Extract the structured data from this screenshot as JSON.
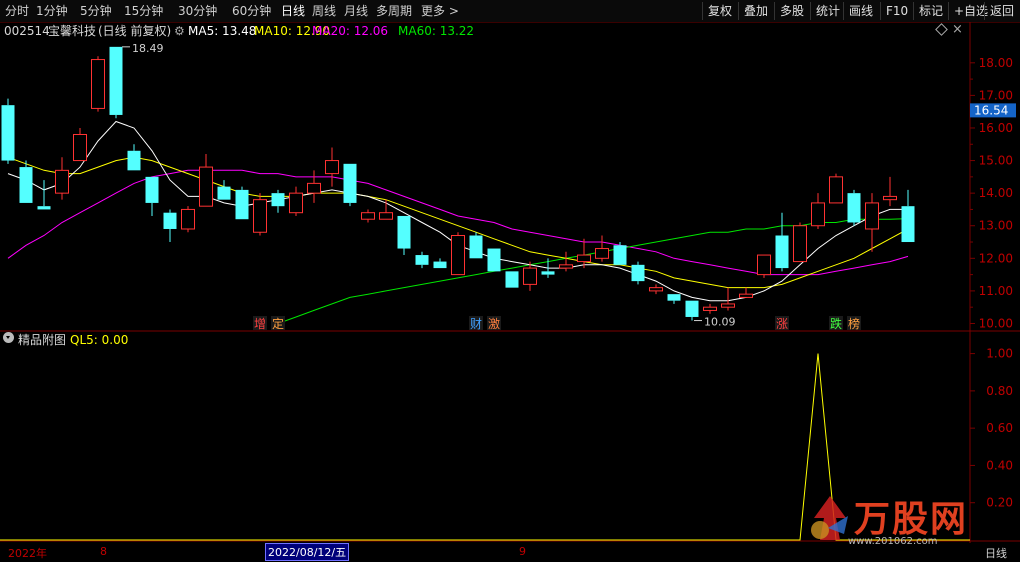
{
  "toolbar": {
    "periods": [
      "分时",
      "1分钟",
      "5分钟",
      "15分钟",
      "30分钟",
      "60分钟",
      "日线",
      "周线",
      "月线",
      "多周期",
      "更多"
    ],
    "active_period": "日线",
    "right_buttons": [
      "复权",
      "叠加",
      "多股",
      "统计",
      "画线",
      "F10",
      "标记",
      "+自选",
      "返回"
    ]
  },
  "stock": {
    "code": "002514",
    "name": "宝馨科技",
    "mode": "(日线 前复权)"
  },
  "ma": {
    "ma5": "MA5: 13.48",
    "ma10": "MA10: 12.90",
    "ma20": "MA20: 12.06",
    "ma60": "MA60: 13.22"
  },
  "colors": {
    "up": "#ff3232",
    "down": "#54ffff",
    "ma5": "#ffffff",
    "ma10": "#ffff00",
    "ma20": "#ff00ff",
    "ma60": "#00e600",
    "grid": "#7a0000",
    "axis_text": "#c00000",
    "ql5": "#ffff00"
  },
  "price_axis": {
    "labels": [
      "18.00",
      "17.00",
      "16.00",
      "15.00",
      "14.00",
      "13.00",
      "12.00",
      "11.00",
      "10.00"
    ],
    "current_price": "16.54"
  },
  "annotations": {
    "high_label": "18.49",
    "low_label": "10.09"
  },
  "events": [
    {
      "text": "增",
      "color": "#ff4040"
    },
    {
      "text": "定",
      "color": "#ffa040"
    },
    {
      "text": "财",
      "color": "#40a0ff"
    },
    {
      "text": "激",
      "color": "#ff8040"
    },
    {
      "text": "涨",
      "color": "#ff4040"
    },
    {
      "text": "跌",
      "color": "#40ff40"
    },
    {
      "text": "榜",
      "color": "#ffa040"
    }
  ],
  "indicator": {
    "name": "精品附图",
    "ql5_label": "QL5: 0.00",
    "axis_labels": [
      "1.00",
      "0.80",
      "0.60",
      "0.40",
      "0.20"
    ]
  },
  "timeline": {
    "year": "2022年",
    "month1": "8",
    "cursor_date": "2022/08/12/五",
    "month2": "9",
    "period_label": "日线"
  },
  "watermark": {
    "text": "万股网",
    "url": "www.201062.com"
  },
  "candles": [
    {
      "o": 16.7,
      "h": 16.9,
      "l": 14.9,
      "c": 15.0
    },
    {
      "o": 14.8,
      "h": 15.0,
      "l": 13.7,
      "c": 13.7
    },
    {
      "o": 13.6,
      "h": 14.4,
      "l": 13.5,
      "c": 13.5
    },
    {
      "o": 14.0,
      "h": 15.1,
      "l": 13.8,
      "c": 14.7
    },
    {
      "o": 15.0,
      "h": 16.0,
      "l": 15.0,
      "c": 15.8
    },
    {
      "o": 16.6,
      "h": 18.2,
      "l": 16.5,
      "c": 18.1
    },
    {
      "o": 18.49,
      "h": 18.49,
      "l": 16.3,
      "c": 16.4
    },
    {
      "o": 15.3,
      "h": 15.5,
      "l": 14.7,
      "c": 14.7
    },
    {
      "o": 14.5,
      "h": 14.5,
      "l": 13.3,
      "c": 13.7
    },
    {
      "o": 13.4,
      "h": 13.5,
      "l": 12.5,
      "c": 12.9
    },
    {
      "o": 12.9,
      "h": 13.6,
      "l": 12.8,
      "c": 13.5
    },
    {
      "o": 13.6,
      "h": 15.2,
      "l": 13.6,
      "c": 14.8
    },
    {
      "o": 14.2,
      "h": 14.4,
      "l": 13.8,
      "c": 13.8
    },
    {
      "o": 14.1,
      "h": 14.2,
      "l": 13.2,
      "c": 13.2
    },
    {
      "o": 12.8,
      "h": 14.0,
      "l": 12.7,
      "c": 13.8
    },
    {
      "o": 14.0,
      "h": 14.1,
      "l": 13.4,
      "c": 13.6
    },
    {
      "o": 13.4,
      "h": 14.2,
      "l": 13.3,
      "c": 14.0
    },
    {
      "o": 14.0,
      "h": 14.7,
      "l": 13.7,
      "c": 14.3
    },
    {
      "o": 14.6,
      "h": 15.4,
      "l": 14.2,
      "c": 15.0
    },
    {
      "o": 14.9,
      "h": 14.9,
      "l": 13.6,
      "c": 13.7
    },
    {
      "o": 13.2,
      "h": 13.5,
      "l": 13.1,
      "c": 13.4
    },
    {
      "o": 13.2,
      "h": 13.8,
      "l": 13.2,
      "c": 13.4
    },
    {
      "o": 13.3,
      "h": 13.3,
      "l": 12.1,
      "c": 12.3
    },
    {
      "o": 12.1,
      "h": 12.2,
      "l": 11.7,
      "c": 11.8
    },
    {
      "o": 11.9,
      "h": 12.0,
      "l": 11.7,
      "c": 11.7
    },
    {
      "o": 11.5,
      "h": 12.8,
      "l": 11.5,
      "c": 12.7
    },
    {
      "o": 12.7,
      "h": 12.8,
      "l": 12.0,
      "c": 12.0
    },
    {
      "o": 12.3,
      "h": 12.3,
      "l": 11.6,
      "c": 11.6
    },
    {
      "o": 11.6,
      "h": 11.6,
      "l": 11.1,
      "c": 11.1
    },
    {
      "o": 11.2,
      "h": 11.9,
      "l": 11.0,
      "c": 11.7
    },
    {
      "o": 11.6,
      "h": 12.0,
      "l": 11.4,
      "c": 11.5
    },
    {
      "o": 11.7,
      "h": 12.2,
      "l": 11.6,
      "c": 11.8
    },
    {
      "o": 11.9,
      "h": 12.6,
      "l": 11.7,
      "c": 12.1
    },
    {
      "o": 12.0,
      "h": 12.7,
      "l": 11.9,
      "c": 12.3
    },
    {
      "o": 12.4,
      "h": 12.5,
      "l": 11.8,
      "c": 11.8
    },
    {
      "o": 11.8,
      "h": 11.9,
      "l": 11.2,
      "c": 11.3
    },
    {
      "o": 11.0,
      "h": 11.2,
      "l": 10.9,
      "c": 11.1
    },
    {
      "o": 10.9,
      "h": 10.9,
      "l": 10.6,
      "c": 10.7
    },
    {
      "o": 10.7,
      "h": 10.7,
      "l": 10.09,
      "c": 10.2
    },
    {
      "o": 10.4,
      "h": 10.6,
      "l": 10.3,
      "c": 10.5
    },
    {
      "o": 10.5,
      "h": 11.1,
      "l": 10.4,
      "c": 10.6
    },
    {
      "o": 10.8,
      "h": 11.1,
      "l": 10.8,
      "c": 10.9
    },
    {
      "o": 11.5,
      "h": 12.1,
      "l": 11.4,
      "c": 12.1
    },
    {
      "o": 12.7,
      "h": 13.4,
      "l": 11.6,
      "c": 11.7
    },
    {
      "o": 11.9,
      "h": 13.1,
      "l": 11.9,
      "c": 13.0
    },
    {
      "o": 13.0,
      "h": 14.0,
      "l": 12.9,
      "c": 13.7
    },
    {
      "o": 13.7,
      "h": 14.6,
      "l": 13.7,
      "c": 14.5
    },
    {
      "o": 14.0,
      "h": 14.1,
      "l": 13.0,
      "c": 13.1
    },
    {
      "o": 12.9,
      "h": 14.0,
      "l": 12.2,
      "c": 13.7
    },
    {
      "o": 13.8,
      "h": 14.5,
      "l": 13.6,
      "c": 13.9
    },
    {
      "o": 13.6,
      "h": 14.1,
      "l": 12.5,
      "c": 12.5
    }
  ],
  "ma_series": {
    "ma5": [
      14.6,
      14.4,
      14.1,
      14.3,
      14.8,
      15.6,
      16.2,
      16.0,
      15.3,
      14.4,
      13.9,
      13.9,
      13.7,
      13.6,
      13.7,
      13.8,
      13.9,
      14.0,
      14.1,
      14.0,
      13.9,
      13.7,
      13.4,
      13.1,
      12.8,
      12.4,
      12.2,
      12.0,
      11.9,
      11.8,
      11.7,
      11.7,
      11.8,
      11.8,
      11.7,
      11.5,
      11.3,
      11.0,
      10.8,
      10.7,
      10.7,
      10.8,
      11.0,
      11.3,
      11.8,
      12.3,
      12.7,
      13.0,
      13.3,
      13.5,
      13.5
    ],
    "ma10": [
      15.1,
      14.9,
      14.7,
      14.6,
      14.6,
      14.8,
      15.0,
      15.1,
      15.0,
      14.8,
      14.6,
      14.4,
      14.2,
      14.0,
      13.9,
      13.9,
      13.9,
      14.0,
      14.0,
      14.0,
      13.9,
      13.8,
      13.6,
      13.4,
      13.2,
      13.0,
      12.8,
      12.6,
      12.4,
      12.2,
      12.1,
      12.0,
      11.9,
      11.8,
      11.8,
      11.7,
      11.6,
      11.4,
      11.3,
      11.2,
      11.1,
      11.1,
      11.1,
      11.2,
      11.4,
      11.6,
      11.8,
      12.0,
      12.3,
      12.6,
      12.9
    ],
    "ma20": [
      12.0,
      12.4,
      12.7,
      13.1,
      13.4,
      13.7,
      14.0,
      14.3,
      14.5,
      14.6,
      14.7,
      14.7,
      14.7,
      14.7,
      14.6,
      14.6,
      14.5,
      14.5,
      14.5,
      14.4,
      14.3,
      14.1,
      13.9,
      13.7,
      13.5,
      13.3,
      13.2,
      13.1,
      12.9,
      12.8,
      12.7,
      12.6,
      12.5,
      12.5,
      12.4,
      12.3,
      12.2,
      12.0,
      11.9,
      11.8,
      11.7,
      11.6,
      11.5,
      11.5,
      11.5,
      11.5,
      11.6,
      11.7,
      11.8,
      11.9,
      12.06
    ],
    "ma60_start": 15,
    "ma60": [
      10.0,
      10.2,
      10.4,
      10.6,
      10.8,
      10.9,
      11.0,
      11.1,
      11.2,
      11.3,
      11.4,
      11.5,
      11.6,
      11.7,
      11.8,
      11.9,
      12.0,
      12.1,
      12.2,
      12.3,
      12.4,
      12.5,
      12.6,
      12.7,
      12.8,
      12.8,
      12.9,
      12.9,
      13.0,
      13.0,
      13.1,
      13.1,
      13.2,
      13.2,
      13.2,
      13.22
    ]
  },
  "ql5_series": {
    "values": [
      0,
      0,
      0,
      0,
      0,
      0,
      0,
      0,
      0,
      0,
      0,
      0,
      0,
      0,
      0,
      0,
      0,
      0,
      0,
      0,
      0,
      0,
      0,
      0,
      0,
      0,
      0,
      0,
      0,
      0,
      0,
      0,
      0,
      0,
      0,
      0,
      0,
      0,
      0,
      0,
      0,
      0,
      0,
      0,
      0,
      1.0,
      0,
      0,
      0,
      0,
      0
    ]
  }
}
